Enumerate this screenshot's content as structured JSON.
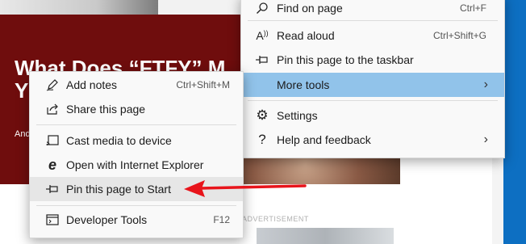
{
  "background": {
    "headline": "What Does “FTFY” M Y",
    "byline": "And",
    "ad_label": "ADVERTISEMENT"
  },
  "main_menu": {
    "items": [
      {
        "label": "Find on page",
        "shortcut": "Ctrl+F",
        "icon": "search-icon"
      },
      {
        "label": "Read aloud",
        "shortcut": "Ctrl+Shift+G",
        "icon": "read-aloud-icon"
      },
      {
        "label": "Pin this page to the taskbar",
        "shortcut": "",
        "icon": "pin-icon"
      },
      {
        "label": "More tools",
        "shortcut": "",
        "icon": "",
        "submenu": true,
        "highlighted": true
      },
      {
        "label": "Settings",
        "shortcut": "",
        "icon": "gear-icon"
      },
      {
        "label": "Help and feedback",
        "shortcut": "",
        "icon": "question-icon",
        "submenu": true
      }
    ]
  },
  "sub_menu": {
    "items": [
      {
        "label": "Add notes",
        "shortcut": "Ctrl+Shift+M",
        "icon": "pen-icon"
      },
      {
        "label": "Share this page",
        "shortcut": "",
        "icon": "share-icon"
      },
      {
        "label": "Cast media to device",
        "shortcut": "",
        "icon": "cast-icon"
      },
      {
        "label": "Open with Internet Explorer",
        "shortcut": "",
        "icon": "internet-explorer-icon"
      },
      {
        "label": "Pin this page to Start",
        "shortcut": "",
        "icon": "pin-icon",
        "hovered": true
      },
      {
        "label": "Developer Tools",
        "shortcut": "F12",
        "icon": "developer-tools-icon"
      }
    ]
  },
  "colors": {
    "highlight": "#91c3ea",
    "arrow": "#e8141b",
    "hero": "#6f0d0d",
    "desktop": "#0b72c4"
  }
}
